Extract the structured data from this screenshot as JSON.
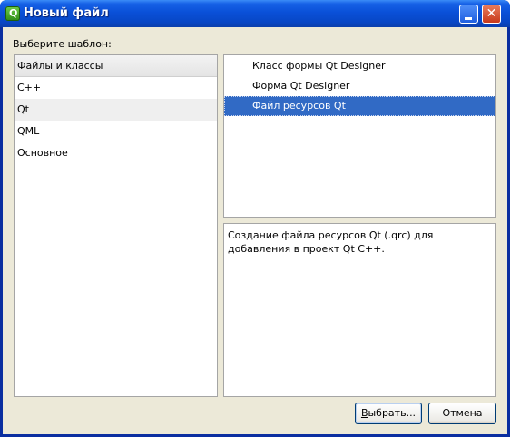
{
  "window": {
    "title": "Новый файл",
    "app_icon": "qt-logo-icon"
  },
  "titlebar_buttons": {
    "minimize_icon": "minimize-icon",
    "close_icon": "close-icon",
    "close_glyph": "✕"
  },
  "prompt": "Выберите шаблон:",
  "categories": {
    "header": "Файлы и классы",
    "items": [
      "C++",
      "Qt",
      "QML",
      "Основное"
    ],
    "selected": "Qt"
  },
  "templates": {
    "items": [
      "Класс формы Qt Designer",
      "Форма Qt Designer",
      "Файл ресурсов Qt"
    ],
    "selected": "Файл ресурсов Qt"
  },
  "description": "Создание файла ресурсов Qt (.qrc) для добавления в проект Qt C++.",
  "buttons": {
    "select_label_mnemonic": "В",
    "select_label_rest": "ыбрать...",
    "cancel": "Отмена"
  },
  "colors": {
    "selection": "#316ac5",
    "dialog_bg": "#ece9d8",
    "titlebar": "#0a50d8"
  }
}
